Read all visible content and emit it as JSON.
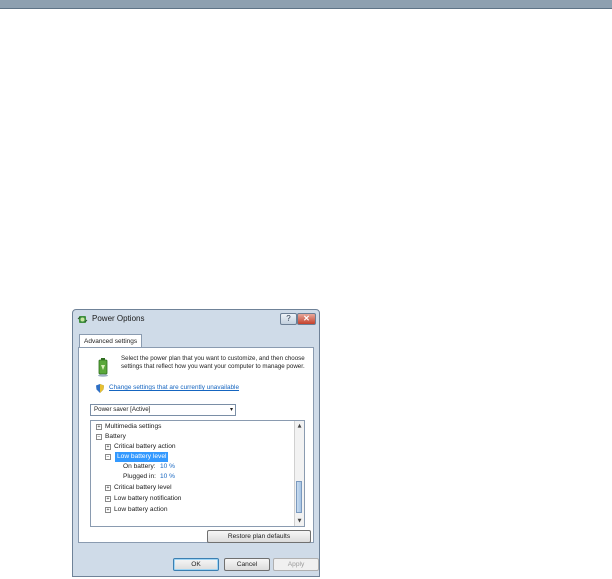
{
  "window": {
    "title": "Power Options",
    "help_label": "?",
    "close_label": "✕"
  },
  "tabs": [
    {
      "label": "Advanced settings"
    }
  ],
  "description": "Select the power plan that you want to customize, and then choose settings that reflect how you want your computer to manage power.",
  "change_settings_link": "Change settings that are currently unavailable",
  "plan_dropdown": {
    "selected": "Power saver [Active]"
  },
  "tree": {
    "multimedia": "Multimedia settings",
    "battery": "Battery",
    "critical_action": "Critical battery action",
    "low_level": "Low battery level",
    "on_battery_label": "On battery:",
    "on_battery_value": "10 %",
    "plugged_in_label": "Plugged in:",
    "plugged_in_value": "10 %",
    "critical_level": "Critical battery level",
    "low_notification": "Low battery notification",
    "low_action": "Low battery action"
  },
  "buttons": {
    "restore": "Restore plan defaults",
    "ok": "OK",
    "cancel": "Cancel",
    "apply": "Apply"
  },
  "colors": {
    "selection": "#3399ff",
    "link": "#1565c0"
  }
}
